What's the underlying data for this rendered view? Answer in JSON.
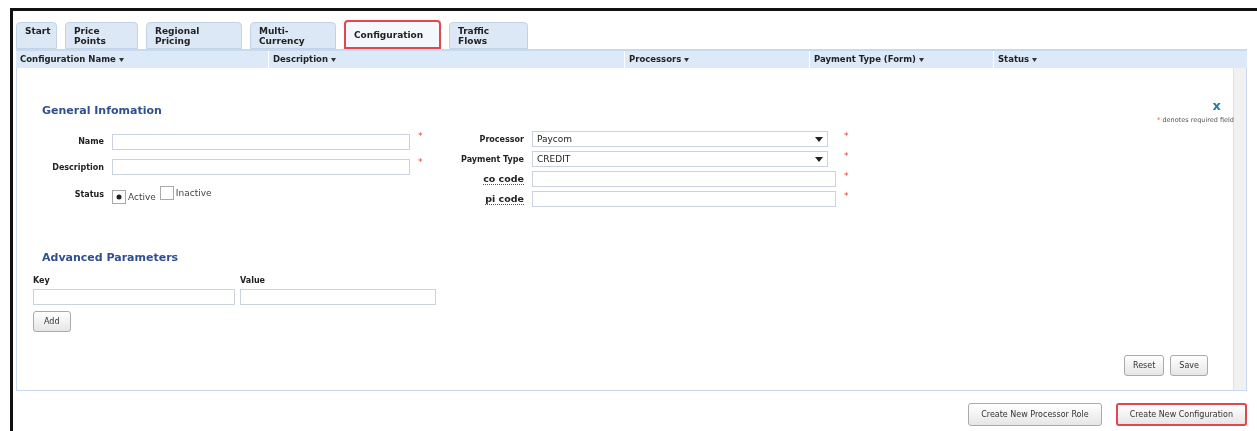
{
  "tabs": [
    {
      "label": "Start",
      "selected": false,
      "highlighted": false
    },
    {
      "label": "Price Points",
      "selected": false,
      "highlighted": false
    },
    {
      "label": "Regional Pricing",
      "selected": false,
      "highlighted": false
    },
    {
      "label": "Multi-Currency",
      "selected": false,
      "highlighted": false
    },
    {
      "label": "Configuration",
      "selected": true,
      "highlighted": true
    },
    {
      "label": "Traffic Flows",
      "selected": false,
      "highlighted": false
    }
  ],
  "table": {
    "columns": [
      "Configuration Name",
      "Description",
      "Processors",
      "Payment Type (Form)",
      "Status"
    ]
  },
  "form": {
    "close": "x",
    "required_note": "denotes required field",
    "required_mark": "*",
    "general": {
      "title": "General Infomation",
      "fields": [
        {
          "label": "Name",
          "required": true
        },
        {
          "label": "Description",
          "required": true
        }
      ],
      "status": {
        "label": "Status",
        "options": [
          {
            "label": "Active",
            "selected": true
          },
          {
            "label": "Inactive",
            "selected": false
          }
        ]
      }
    },
    "processor_fields": [
      {
        "label": "Processor",
        "kind": "select",
        "value": "Paycom",
        "required": true,
        "dotted": false
      },
      {
        "label": "Payment Type",
        "kind": "select",
        "value": "CREDIT",
        "required": true,
        "dotted": false
      },
      {
        "label": "co code",
        "kind": "text",
        "required": true,
        "dotted": true
      },
      {
        "label": "pi code",
        "kind": "text",
        "required": true,
        "dotted": true
      }
    ],
    "advanced": {
      "title": "Advanced Parameters",
      "key_label": "Key",
      "value_label": "Value",
      "add_button": "Add"
    },
    "buttons": [
      "Reset",
      "Save"
    ]
  },
  "footer_buttons": [
    {
      "label": "Create New Processor Role",
      "highlighted": false
    },
    {
      "label": "Create New Configuration",
      "highlighted": true
    }
  ]
}
